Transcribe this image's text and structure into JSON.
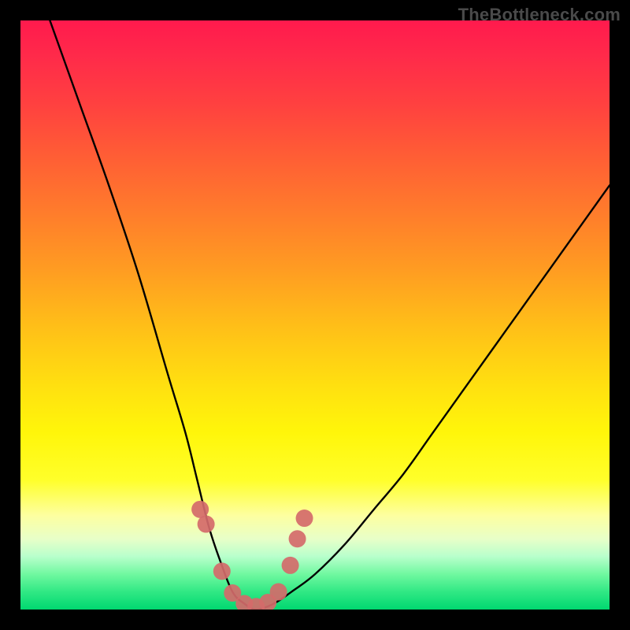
{
  "watermark": "TheBottleneck.com",
  "chart_data": {
    "type": "line",
    "title": "",
    "xlabel": "",
    "ylabel": "",
    "xlim": [
      0,
      100
    ],
    "ylim": [
      0,
      100
    ],
    "grid": false,
    "legend": false,
    "series": [
      {
        "name": "left-branch",
        "x": [
          5,
          10,
          15,
          20,
          25,
          28,
          30,
          32,
          34,
          36,
          38,
          40
        ],
        "values": [
          100,
          86,
          72,
          57,
          40,
          30,
          22,
          14,
          8,
          3,
          1,
          0
        ]
      },
      {
        "name": "right-branch",
        "x": [
          40,
          43,
          46,
          50,
          55,
          60,
          65,
          70,
          75,
          80,
          85,
          90,
          95,
          100
        ],
        "values": [
          0,
          1,
          3,
          6,
          11,
          17,
          23,
          30,
          37,
          44,
          51,
          58,
          65,
          72
        ]
      }
    ],
    "markers": {
      "name": "valley-dots",
      "x": [
        30.5,
        31.5,
        34.2,
        36.0,
        38.0,
        40.0,
        42.0,
        43.8,
        45.8,
        47.0,
        48.2
      ],
      "values": [
        17.0,
        14.5,
        6.5,
        2.8,
        1.0,
        0.5,
        1.2,
        3.0,
        7.5,
        12.0,
        15.5
      ]
    },
    "background_gradient": {
      "stops": [
        {
          "pos": 0.0,
          "color": "#ff1a4d"
        },
        {
          "pos": 0.5,
          "color": "#ffbf18"
        },
        {
          "pos": 0.8,
          "color": "#ffff2a"
        },
        {
          "pos": 1.0,
          "color": "#00d870"
        }
      ]
    },
    "curve_color": "#000000",
    "marker_color": "#d46a6a"
  }
}
